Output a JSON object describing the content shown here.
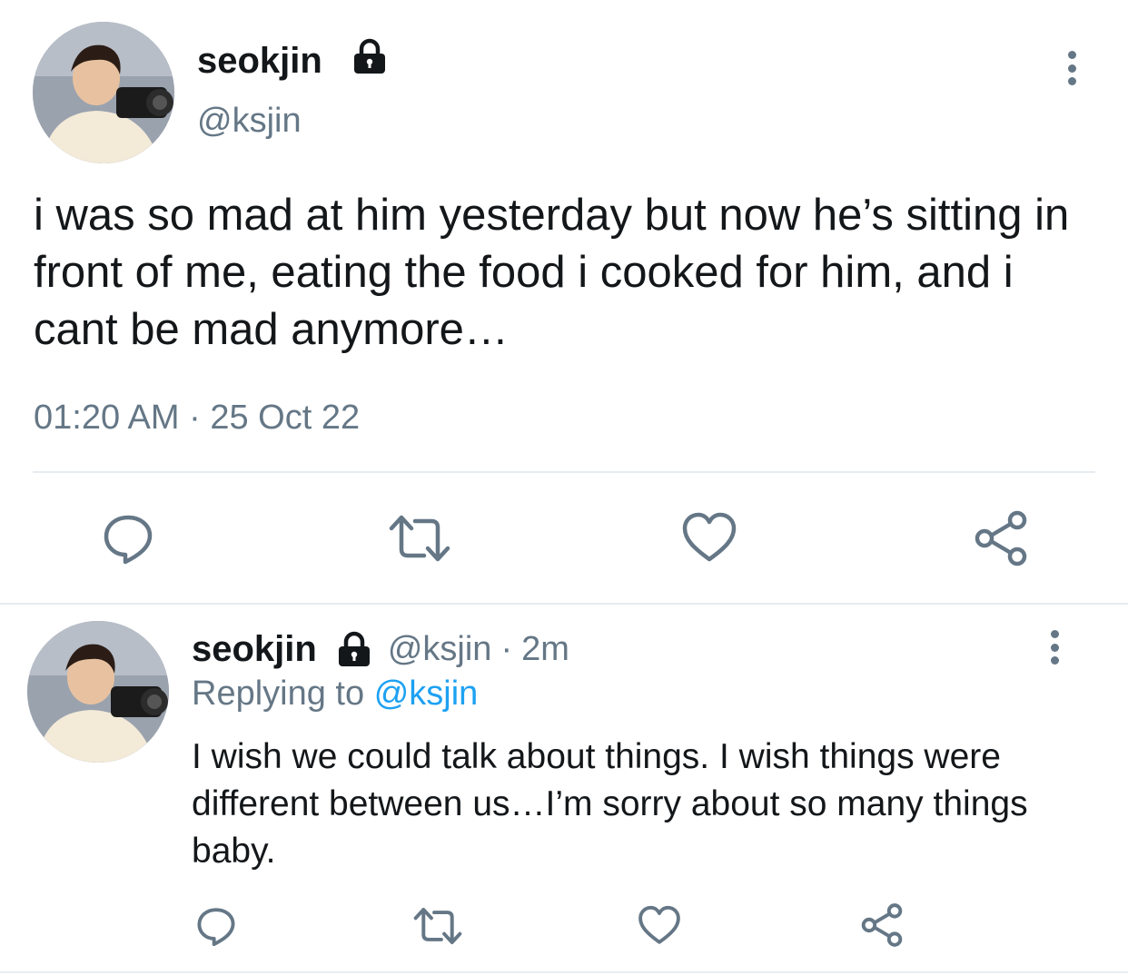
{
  "main_tweet": {
    "display_name": "seokjin",
    "handle": "@ksjin",
    "text": "i was so mad at him yesterday but now he’s sitting in front of me, eating the food i cooked for him, and i cant be mad anymore…",
    "time": "01:20 AM",
    "separator": "·",
    "date": "25 Oct 22",
    "actions": [
      "reply",
      "retweet",
      "like",
      "share"
    ]
  },
  "reply_tweet": {
    "display_name": "seokjin",
    "handle": "@ksjin",
    "separator": "·",
    "age": "2m",
    "replying_prefix": "Replying to",
    "replying_handle": "@ksjin",
    "text": "I wish we could talk about things. I wish things were different between us…I’m sorry about so many things baby.",
    "actions": [
      "reply",
      "retweet",
      "like",
      "share"
    ]
  },
  "colors": {
    "text": "#14171a",
    "muted": "#657786",
    "link": "#1da1f2",
    "divider": "#e6ecf0"
  },
  "icons": [
    "lock-icon",
    "more-options-icon",
    "reply-icon",
    "retweet-icon",
    "like-icon",
    "share-icon"
  ]
}
